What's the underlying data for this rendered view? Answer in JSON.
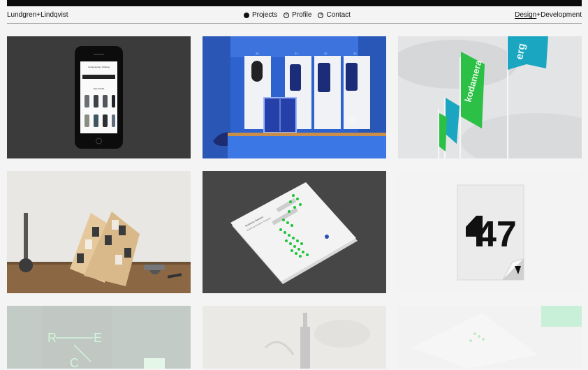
{
  "header": {
    "brand": "Lundgren+Lindqvist",
    "nav": [
      {
        "icon": "filled-dot",
        "label": "Projects"
      },
      {
        "icon": "circled-2",
        "label": "Profile"
      },
      {
        "icon": "circled-3",
        "label": "Contact"
      }
    ],
    "services": {
      "active": "Design",
      "sep": "+",
      "other": "Development"
    }
  },
  "tiles": {
    "phone": {
      "shop_title": "Contemporary Clothing",
      "section": "New Arrivals"
    },
    "lockers": {
      "numbers": [
        "20",
        "21",
        "22",
        "23"
      ]
    },
    "flags": {
      "text": "kodamera",
      "partial": "erg"
    },
    "book": {
      "title": "Business Sweden",
      "subtitle": "Exploring Swedish Prospects"
    },
    "logo": {
      "text": "47"
    },
    "faded_letters": [
      "R",
      "E",
      "C"
    ]
  },
  "colors": {
    "accent_green": "#1ec43a",
    "locker_blue": "#2f6ad8",
    "flag_green": "#2cc046",
    "flag_teal": "#1aa6c0"
  }
}
